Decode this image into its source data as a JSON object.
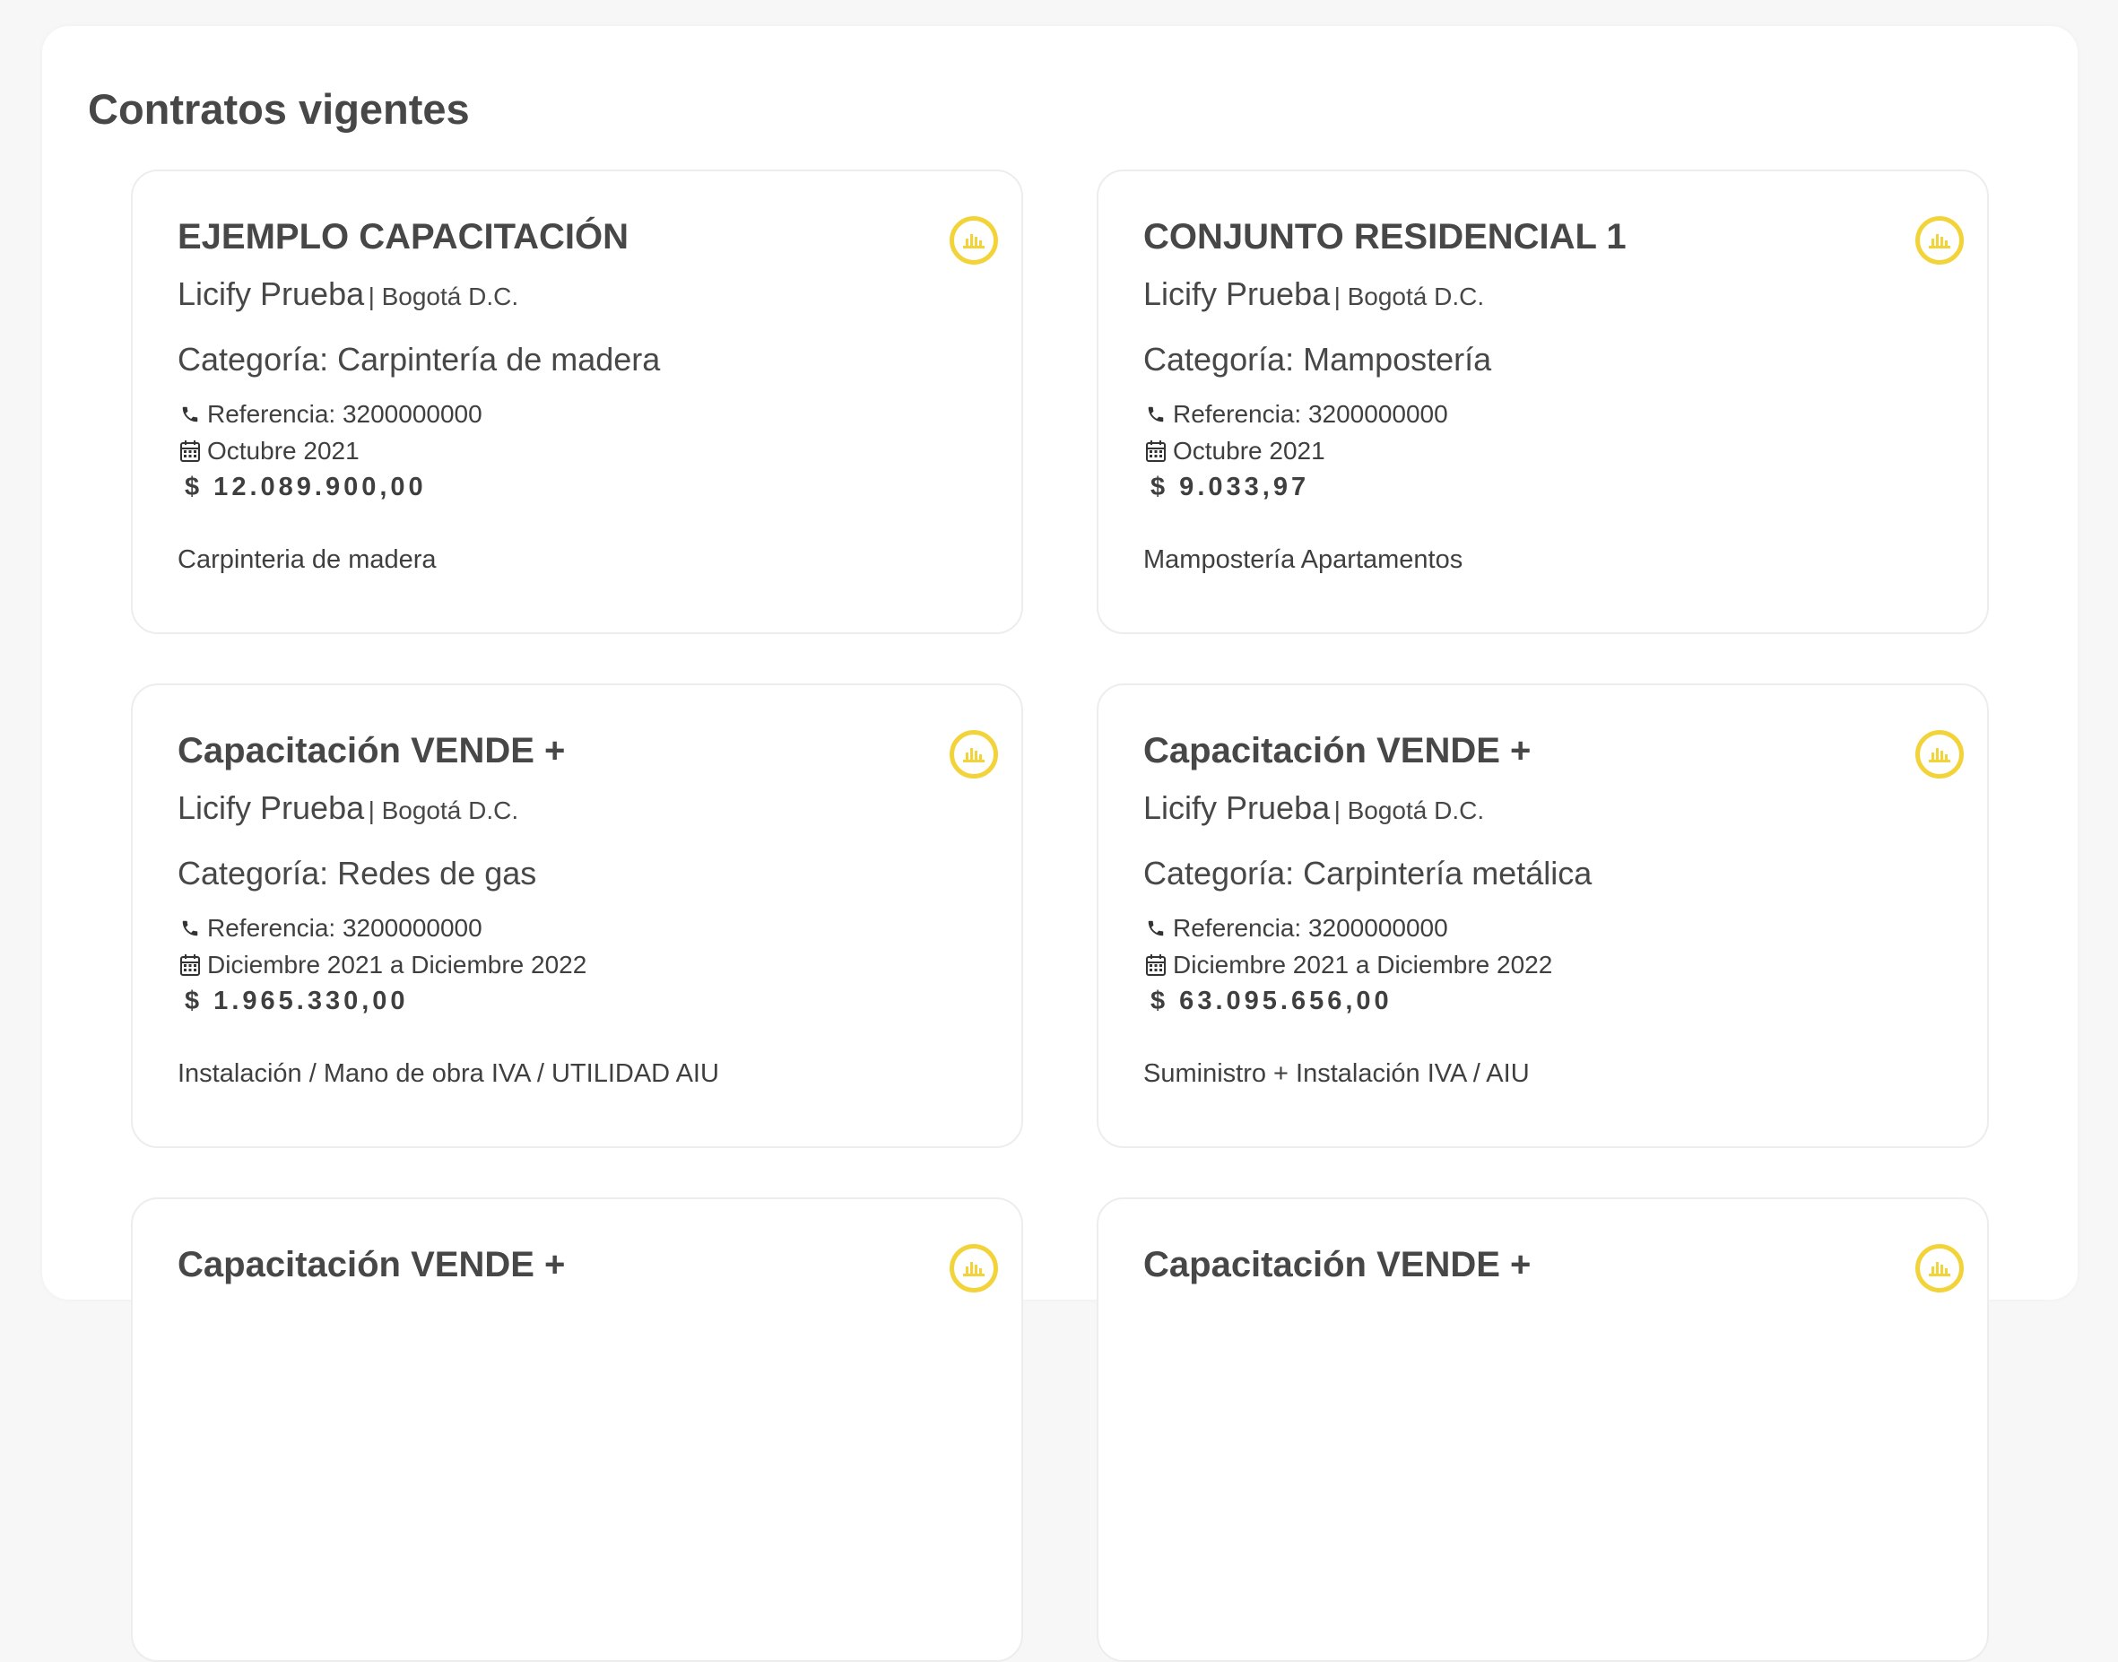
{
  "page": {
    "title": "Contratos vigentes"
  },
  "colors": {
    "accent": "#f2d33a",
    "text": "#474747",
    "card_border": "#ededed"
  },
  "cards": [
    {
      "title": "EJEMPLO CAPACITACIÓN",
      "client": "Licify Prueba",
      "city": "| Bogotá D.C.",
      "category": "Categoría: Carpintería de madera",
      "reference": "Referencia: 3200000000",
      "date": "Octubre 2021",
      "amount": "$ 12.089.900,00",
      "description": "Carpinteria de madera",
      "icon": "chart-bar-icon"
    },
    {
      "title": "CONJUNTO RESIDENCIAL 1",
      "client": "Licify Prueba",
      "city": "| Bogotá D.C.",
      "category": "Categoría: Mampostería",
      "reference": "Referencia: 3200000000",
      "date": "Octubre 2021",
      "amount": "$ 9.033,97",
      "description": "Mampostería Apartamentos",
      "icon": "chart-bar-icon"
    },
    {
      "title": "Capacitación VENDE +",
      "client": "Licify Prueba",
      "city": "| Bogotá D.C.",
      "category": "Categoría: Redes de gas",
      "reference": "Referencia: 3200000000",
      "date": "Diciembre 2021 a Diciembre 2022",
      "amount": "$ 1.965.330,00",
      "description": "Instalación / Mano de obra IVA / UTILIDAD AIU",
      "icon": "chart-bar-icon"
    },
    {
      "title": "Capacitación VENDE +",
      "client": "Licify Prueba",
      "city": "| Bogotá D.C.",
      "category": "Categoría: Carpintería metálica",
      "reference": "Referencia: 3200000000",
      "date": "Diciembre 2021 a Diciembre 2022",
      "amount": "$ 63.095.656,00",
      "description": "Suministro + Instalación IVA / AIU",
      "icon": "chart-bar-icon"
    },
    {
      "title": "Capacitación VENDE +",
      "client": "",
      "city": "",
      "category": "",
      "reference": "",
      "date": "",
      "amount": "",
      "description": "",
      "icon": "chart-bar-icon"
    },
    {
      "title": "Capacitación VENDE +",
      "client": "",
      "city": "",
      "category": "",
      "reference": "",
      "date": "",
      "amount": "",
      "description": "",
      "icon": "chart-bar-icon"
    }
  ]
}
